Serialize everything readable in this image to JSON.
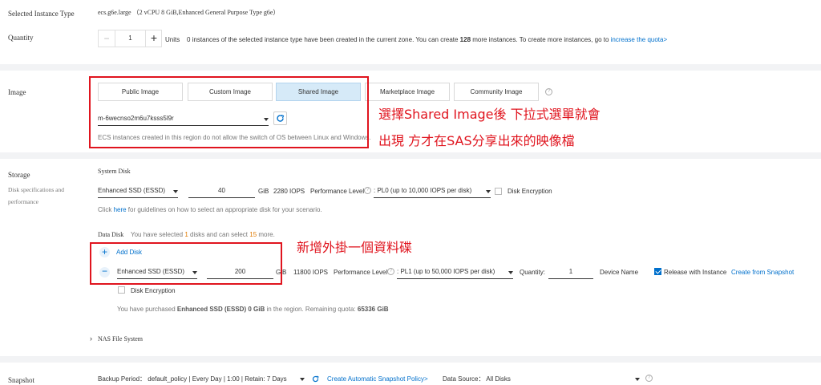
{
  "instance": {
    "label": "Selected Instance Type",
    "value": "ecs.g6e.large （2 vCPU 8 GiB,Enhanced General Purpose Type g6e）"
  },
  "quantity": {
    "label": "Quantity",
    "minus": "−",
    "value": "1",
    "plus": "+",
    "units": "Units",
    "info_prefix": "0 instances of the selected instance type have been created in the current zone. You can create ",
    "info_count": "128",
    "info_suffix": " more instances. To create more instances, go to ",
    "info_link": "increase the quota>"
  },
  "image": {
    "label": "Image",
    "tabs": [
      "Public Image",
      "Custom Image",
      "Shared Image",
      "Marketplace Image",
      "Community Image"
    ],
    "active_tab": "Shared Image",
    "selected": "m-6wecnso2m6u7ksss5l9r",
    "note": "ECS instances created in this region do not allow the switch of OS between Linux and Windows."
  },
  "annotations": {
    "image_line1": "選擇Shared Image後 下拉式選單就會",
    "image_line2": "出現 方才在SAS分享出來的映像檔",
    "disk": "新增外掛一個資料碟"
  },
  "storage": {
    "label": "Storage",
    "sublabel_1": "Disk specifications and",
    "sublabel_2": "performance",
    "system_disk_title": "System Disk",
    "system_disk": {
      "category": "Enhanced SSD (ESSD)",
      "size": "40",
      "unit": "GiB",
      "iops": "2280 IOPS",
      "perf_label": "Performance Level",
      "perf_value": ": PL0 (up to 10,000 IOPS per disk)",
      "encryption": "Disk Encryption"
    },
    "guide_prefix": "Click ",
    "guide_link": "here",
    "guide_suffix": " for guidelines on how to select an appropriate disk for your scenario.",
    "data_disk_title": "Data Disk",
    "data_disk_info_prefix": "You have selected ",
    "data_disk_selected": "1",
    "data_disk_info_mid": " disks and can select ",
    "data_disk_max": "15",
    "data_disk_info_suffix": " more.",
    "add_disk": "Add Disk",
    "data_disk": {
      "remove": "−",
      "category": "Enhanced SSD (ESSD)",
      "size": "200",
      "unit": "GiB",
      "iops": "11800 IOPS",
      "perf_label": "Performance Level",
      "perf_value": ": PL1 (up to 50,000 IOPS per disk)",
      "quantity_label": "Quantity:",
      "quantity": "1",
      "device_name": "Device Name",
      "release": "Release with Instance",
      "release_checked": true,
      "create_from_snapshot": "Create from Snapshot",
      "encryption": "Disk Encryption"
    },
    "purchased_prefix": "You have purchased ",
    "purchased_bold": "Enhanced SSD (ESSD) 0 GiB",
    "purchased_mid": " in the region. Remaining quota: ",
    "purchased_quota": "65336 GiB",
    "nas": "NAS File System"
  },
  "snapshot": {
    "label": "Snapshot",
    "backup_period": "Backup Period： default_policy | Every Day | 1:00 | Retain: 7 Days",
    "create_policy": "Create Automatic Snapshot Policy>",
    "data_source": "Data Source： All Disks"
  },
  "colors": {
    "accent": "#0070cc",
    "annotation": "#e0141e",
    "active_tab_bg": "#d6eaf8"
  }
}
